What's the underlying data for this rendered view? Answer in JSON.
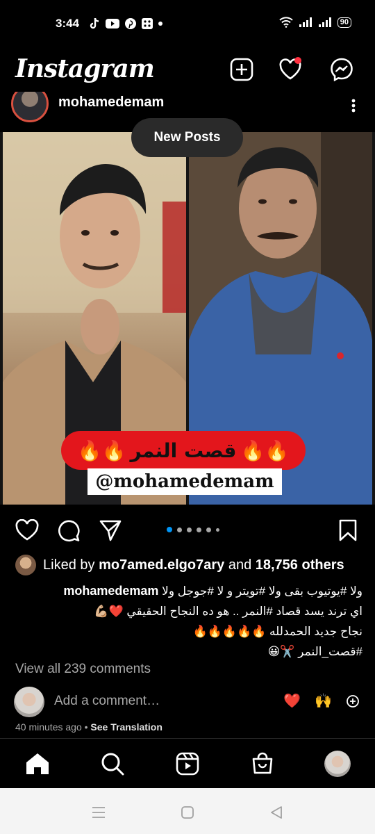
{
  "status_bar": {
    "time": "3:44",
    "battery": "90",
    "left_icons": [
      "tiktok-icon",
      "youtube-icon",
      "pinterest-icon",
      "app-icon",
      "dot-icon"
    ],
    "right_icons": [
      "wifi-icon",
      "signal-icon",
      "signal-icon"
    ]
  },
  "header": {
    "logo": "Instagram",
    "icons": [
      "create-post-icon",
      "activity-heart-icon",
      "messenger-icon"
    ],
    "notification_color": "#ff3040"
  },
  "post": {
    "username": "mohamedemam",
    "new_posts_label": "New Posts",
    "image": {
      "banner_text": "قصت النمر",
      "banner_emoji_left": "🔥🔥",
      "banner_emoji_right": "🔥🔥",
      "handle_text": "@mohamedemam"
    },
    "carousel": {
      "total": 6,
      "active": 0
    },
    "likes": {
      "prefix": "Liked by ",
      "user": "mo7amed.elgo7ary",
      "middle": " and ",
      "count": "18,756 others"
    },
    "caption": {
      "user": "mohamedemam",
      "line1": "ولا #يوتيوب بقى ولا #تويتر و لا #جوجل ولا",
      "line2": "اي ترند يسد قصاد #النمر .. هو ده النجاح الحقيقي ❤️💪🏼",
      "line3": "نجاح جديد الحمدلله 🔥🔥🔥🔥🔥",
      "line4": "#قصت_النمر ✂️😀"
    },
    "view_comments": "View all 239 comments",
    "add_comment_placeholder": "Add a comment…",
    "quick_reactions": [
      "❤️",
      "🙌"
    ],
    "time_ago": "40 minutes ago",
    "separator": " • ",
    "see_translation": "See Translation"
  },
  "bottom_nav": [
    "home-icon",
    "search-icon",
    "reels-icon",
    "shop-icon",
    "profile-avatar"
  ],
  "colors": {
    "background": "#000000",
    "accent_blue": "#0095f6",
    "banner_red": "#e3161c",
    "muted_text": "#a8a8a8"
  }
}
